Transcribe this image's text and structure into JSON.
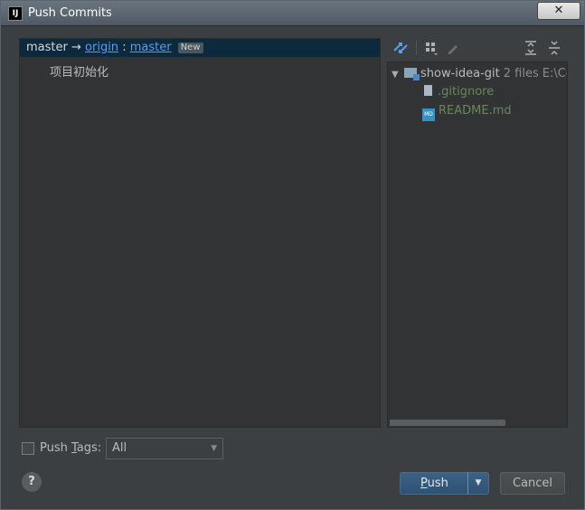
{
  "window": {
    "title": "Push Commits",
    "app_icon": "intellij-icon",
    "close_label": "✕"
  },
  "push_spec": {
    "local_branch": "master",
    "arrow": "→",
    "remote": "origin",
    "separator": ":",
    "remote_branch": "master",
    "badge": "New"
  },
  "commits": [
    {
      "message": "项目初始化"
    }
  ],
  "files_toolbar": {
    "icons": [
      "show-diff-icon",
      "group-by-icon",
      "edit-source-icon",
      "expand-all-icon",
      "collapse-all-icon"
    ]
  },
  "file_tree": {
    "root": {
      "name": "show-idea-git",
      "count": "2 files",
      "path": "E:\\Cod"
    },
    "files": [
      {
        "name": ".gitignore",
        "icon": "text-file-icon",
        "color": "#6a8759"
      },
      {
        "name": "README.md",
        "icon": "markdown-file-icon",
        "color": "#6a8759"
      }
    ]
  },
  "footer": {
    "push_tags_label_prefix": "Push ",
    "push_tags_label_mnemonic": "T",
    "push_tags_label_suffix": "ags:",
    "push_tags_checked": false,
    "tags_select_value": "All",
    "help_label": "?",
    "push_label_mnemonic": "P",
    "push_label_rest": "ush",
    "cancel_label": "Cancel"
  },
  "colors": {
    "accent": "#589df6",
    "selection": "#0d293e",
    "added_file": "#6a8759",
    "primary_button": "#365880"
  }
}
